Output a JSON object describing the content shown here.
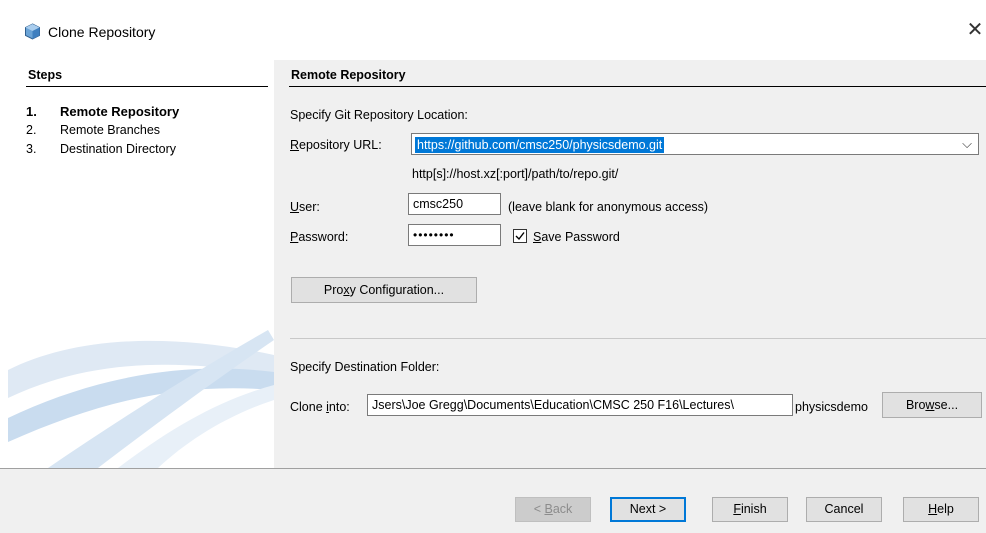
{
  "window": {
    "title": "Clone Repository",
    "close_glyph": "✕"
  },
  "steps": {
    "title": "Steps",
    "items": [
      {
        "num": "1.",
        "label": "Remote Repository"
      },
      {
        "num": "2.",
        "label": "Remote Branches"
      },
      {
        "num": "3.",
        "label": "Destination Directory"
      }
    ]
  },
  "panel": {
    "title": "Remote Repository",
    "location_heading": "Specify Git Repository Location:",
    "repo_url": {
      "label_pre": "",
      "label_key": "R",
      "label_post": "epository URL:",
      "value": "https://github.com/cmsc250/physicsdemo.git",
      "hint": "http[s]://host.xz[:port]/path/to/repo.git/",
      "arrow_glyph": "⌵"
    },
    "user": {
      "label_pre": "",
      "label_key": "U",
      "label_post": "ser:",
      "value": "cmsc250",
      "hint": "(leave blank for anonymous access)"
    },
    "password": {
      "label_pre": "",
      "label_key": "P",
      "label_post": "assword:",
      "value": "••••••••"
    },
    "save_password": {
      "label_pre": "",
      "label_key": "S",
      "label_post": "ave Password",
      "checked": true
    },
    "proxy_button": {
      "label_pre": "Pro",
      "label_key": "x",
      "label_post": "y Configuration..."
    },
    "destination_heading": "Specify Destination Folder:",
    "clone_into": {
      "label_pre": "Clone ",
      "label_key": "i",
      "label_post": "nto:",
      "path": "Jsers\\Joe Gregg\\Documents\\Education\\CMSC 250 F16\\Lectures\\",
      "folder": "physicsdemo"
    },
    "browse_button": {
      "label_pre": "Bro",
      "label_key": "w",
      "label_post": "se..."
    }
  },
  "footer": {
    "back": {
      "label_pre": "< ",
      "label_key": "B",
      "label_post": "ack"
    },
    "next": {
      "label": "Next >"
    },
    "finish": {
      "label_pre": "",
      "label_key": "F",
      "label_post": "inish"
    },
    "cancel": {
      "label": "Cancel"
    },
    "help": {
      "label_pre": "",
      "label_key": "H",
      "label_post": "elp"
    }
  },
  "colors": {
    "selection": "#0078d7",
    "panel_bg": "#f0f0f0",
    "accent_swoosh": "#c9dcef"
  }
}
